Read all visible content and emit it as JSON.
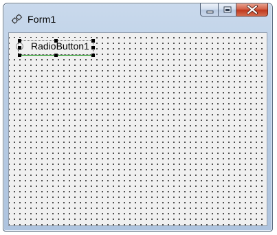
{
  "window": {
    "title": "Form1"
  },
  "titlebar": {
    "icon": "gear-app-icon",
    "buttons": [
      {
        "icon": "minimize-icon"
      },
      {
        "icon": "maximize-icon"
      },
      {
        "icon": "close-icon"
      }
    ]
  },
  "form": {
    "grid": "dotted",
    "background_color": "#f0f0f0",
    "radio_button": {
      "label": "RadioButton1",
      "checked": false,
      "selected_in_designer": true,
      "selection_handle_color": "#000000",
      "baseline_color": "#2ea02e"
    }
  },
  "colors": {
    "title_bar": "#b9cde5",
    "close_button": "#c7442a"
  }
}
